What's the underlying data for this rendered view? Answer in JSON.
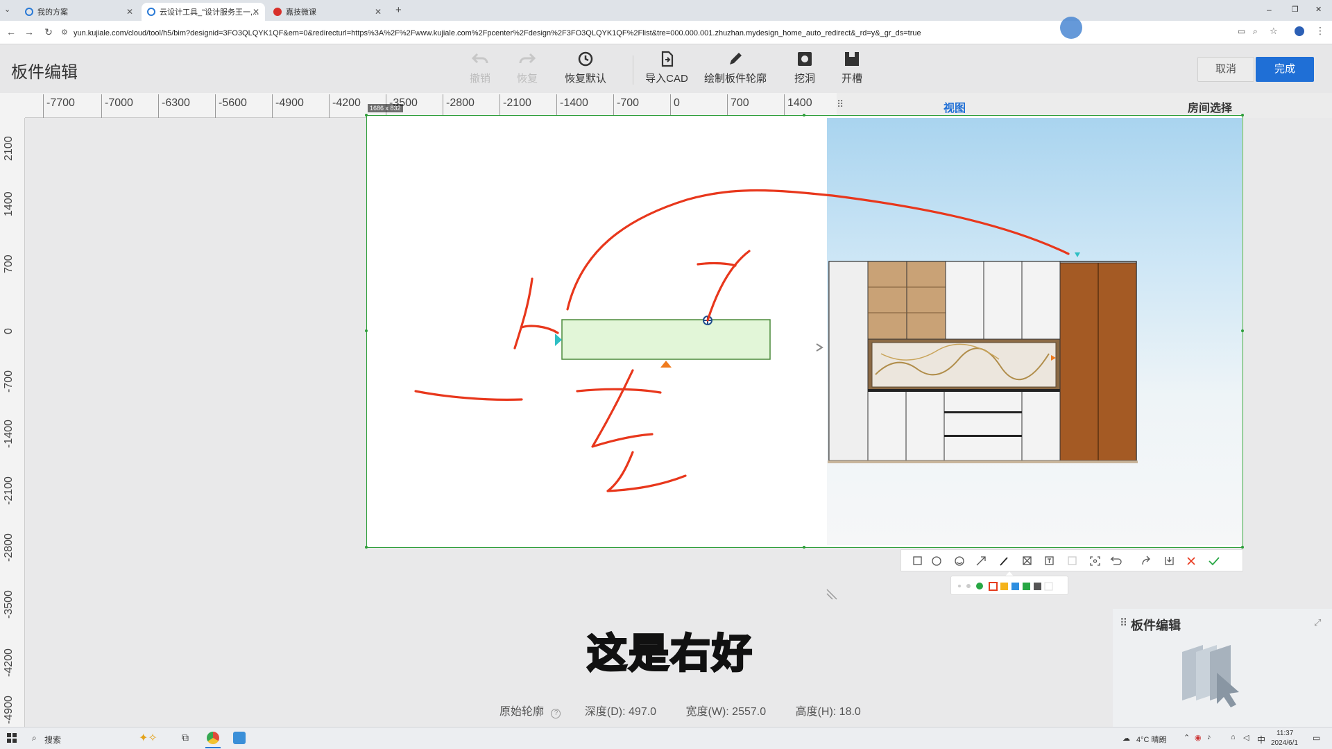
{
  "browser": {
    "tabs": [
      {
        "label": "我的方案"
      },
      {
        "label": "云设计工具_\"设计服务王一,..."
      },
      {
        "label": "嘉技微课"
      }
    ],
    "new_tab": "+",
    "url": "yun.kujiale.com/cloud/tool/h5/bim?designid=3FO3QLQYK1QF&em=0&redirecturl=https%3A%2F%2Fwww.kujiale.com%2Fpcenter%2Fdesign%2F3FO3QLQYK1QF%2Flist&tre=000.000.001.zhuzhan.mydesign_home_auto_redirect&_rd=y&_gr_ds=true",
    "window_controls": [
      "–",
      "❐",
      "✕"
    ]
  },
  "header": {
    "title": "板件编辑",
    "tools": [
      {
        "label": "撤销",
        "icon": "undo-icon",
        "enabled": false
      },
      {
        "label": "恢复",
        "icon": "redo-icon",
        "enabled": false
      },
      {
        "label": "恢复默认",
        "icon": "restore-icon",
        "enabled": true
      },
      {
        "label": "导入CAD",
        "icon": "import-cad-icon",
        "enabled": true
      },
      {
        "label": "绘制板件轮廓",
        "icon": "pencil-icon",
        "enabled": true
      },
      {
        "label": "挖洞",
        "icon": "hole-icon",
        "enabled": true
      },
      {
        "label": "开槽",
        "icon": "groove-icon",
        "enabled": true
      }
    ],
    "cancel": "取消",
    "done": "完成"
  },
  "ruler": {
    "h_ticks": [
      "-7700",
      "-7000",
      "-6300",
      "-5600",
      "-4900",
      "-4200",
      "-3500",
      "-2800",
      "-2100",
      "-1400",
      "-700",
      "0",
      "700",
      "1400"
    ],
    "v_ticks": [
      "2100",
      "1400",
      "700",
      "0",
      "-700",
      "-1400",
      "-2100",
      "-2800",
      "-3500",
      "-4200",
      "-4900"
    ]
  },
  "side_tabs": {
    "view": "视图",
    "room": "房间选择"
  },
  "screenshot_size": "1686 x 832",
  "bottom_info": {
    "original_outline": "原始轮廓",
    "depth": "深度(D): 497.0",
    "width": "宽度(W): 2557.0",
    "height": "高度(H): 18.0"
  },
  "subtitle": "这是右好",
  "mini_panel": {
    "title": "板件编辑"
  },
  "annotation_toolbar": {
    "tools": [
      "rect-icon",
      "ellipse-icon",
      "emoji-icon",
      "arrow-icon",
      "pen-icon",
      "mosaic-icon",
      "text-icon",
      "blur-icon",
      "capture-icon",
      "undo-icon",
      "share-icon",
      "save-icon",
      "close-icon",
      "confirm-icon"
    ],
    "colors": [
      "#e53c1e",
      "#f5b31b",
      "#2d8ee0",
      "#27a744",
      "#17914a",
      "#555555",
      "#ffffff"
    ]
  },
  "colors": {
    "accent": "#1f6fd6",
    "ink": "#e8371c",
    "panel": "#e2f6d8"
  },
  "taskbar": {
    "search": "搜索",
    "weather": "4°C 晴朗",
    "ime": "中",
    "time": "11:37",
    "date": "2024/6/1"
  }
}
